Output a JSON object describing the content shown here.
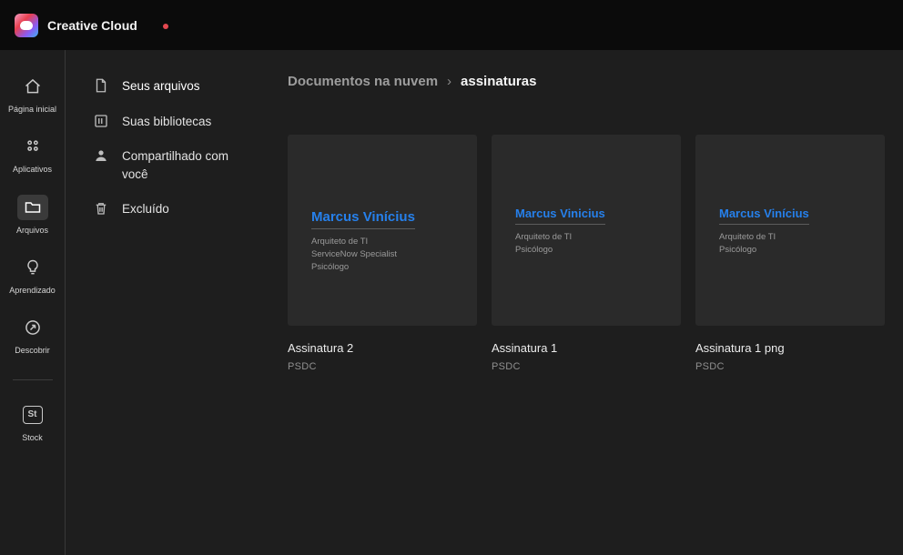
{
  "topbar": {
    "app_name": "Creative Cloud"
  },
  "rail": {
    "items": [
      {
        "label": "Página inicial"
      },
      {
        "label": "Aplicativos"
      },
      {
        "label": "Arquivos"
      },
      {
        "label": "Aprendizado"
      },
      {
        "label": "Descobrir"
      }
    ],
    "stock": {
      "badge": "St",
      "label": "Stock"
    }
  },
  "subnav": {
    "items": [
      {
        "label": "Seus arquivos"
      },
      {
        "label": "Suas bibliotecas"
      },
      {
        "label": "Compartilhado com você"
      },
      {
        "label": "Excluído"
      }
    ]
  },
  "breadcrumb": {
    "parent": "Documentos na nuvem",
    "separator": "›",
    "current": "assinaturas"
  },
  "files": [
    {
      "title": "Assinatura 2",
      "type": "PSDC",
      "preview": {
        "name": "Marcus Vinícius",
        "line1": "Arquiteto de TI",
        "line2": "ServiceNow Specialist",
        "line3": "Psicólogo"
      }
    },
    {
      "title": "Assinatura 1",
      "type": "PSDC",
      "preview": {
        "name": "Marcus Vinicius",
        "line1": "Arquiteto de TI",
        "line2": "Psicólogo"
      }
    },
    {
      "title": "Assinatura 1 png",
      "type": "PSDC",
      "preview": {
        "name": "Marcus Vinícius",
        "line1": "Arquiteto de TI",
        "line2": "Psicólogo"
      }
    }
  ],
  "colors": {
    "accent_blue": "#2680eb",
    "notification_red": "#e34850"
  }
}
